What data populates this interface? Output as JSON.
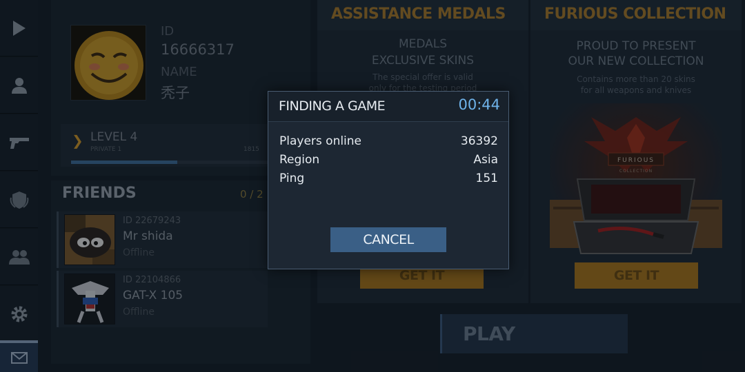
{
  "profile": {
    "id_label": "ID",
    "id_value": "16666317",
    "name_label": "NAME",
    "name_value": "秃子",
    "level_title": "LEVEL 4",
    "rank": "PRIVATE 1",
    "xp": "1815",
    "xp_progress": 0.53
  },
  "friends": {
    "title": "FRIENDS",
    "count": "0 / 2",
    "items": [
      {
        "id": "ID 22679243",
        "name": "Mr shida",
        "status": "Offline"
      },
      {
        "id": "ID 22104866",
        "name": "GAT-X 105",
        "status": "Offline"
      }
    ]
  },
  "cards": {
    "assistance": {
      "title": "ASSISTANCE MEDALS",
      "line1": "MEDALS",
      "line2": "EXCLUSIVE SKINS",
      "desc1": "The special offer is valid",
      "desc2": "only for the testing period",
      "button": "GET IT"
    },
    "furious": {
      "title": "FURIOUS COLLECTION",
      "line1": "PROUD TO PRESENT",
      "line2": "OUR NEW COLLECTION",
      "desc1": "Contains more than 20 skins",
      "desc2": "for all weapons and knives",
      "emblem_text": "FURIOUS",
      "emblem_sub": "COLLECTION",
      "button": "GET IT"
    }
  },
  "play": {
    "label": "PLAY"
  },
  "dialog": {
    "title": "FINDING A GAME",
    "timer": "00:44",
    "stats": [
      {
        "label": "Players online",
        "value": "36392"
      },
      {
        "label": "Region",
        "value": "Asia"
      },
      {
        "label": "Ping",
        "value": "151"
      }
    ],
    "cancel": "CANCEL"
  },
  "colors": {
    "accent_blue": "#6fb3ea",
    "button_blue": "#3a5f86",
    "gold": "#a8761e",
    "panel": "#1b2631"
  },
  "icons": {
    "sidebar": [
      "play-icon",
      "profile-icon",
      "weapon-icon",
      "shield-icon",
      "friends-icon",
      "gear-icon",
      "mail-icon"
    ]
  }
}
